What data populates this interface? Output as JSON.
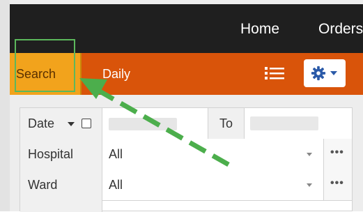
{
  "navbar": {
    "items": [
      {
        "label": "Home"
      },
      {
        "label": "Orders"
      }
    ]
  },
  "toolbar": {
    "search_label": "Search",
    "daily_label": "Daily",
    "list_icon": "list-icon",
    "settings_icon": "gear-icon"
  },
  "filters": {
    "date_label": "Date",
    "to_label": "To",
    "hospital": {
      "label": "Hospital",
      "value": "All"
    },
    "ward": {
      "label": "Ward",
      "value": "All"
    },
    "more_label": "•••"
  },
  "colors": {
    "navbar_bg": "#1f1f1f",
    "toolbar_bg": "#d9540a",
    "search_btn_bg": "#f2a31c",
    "annotation_green": "#5cb85c",
    "gear_blue": "#2b5aa8"
  }
}
